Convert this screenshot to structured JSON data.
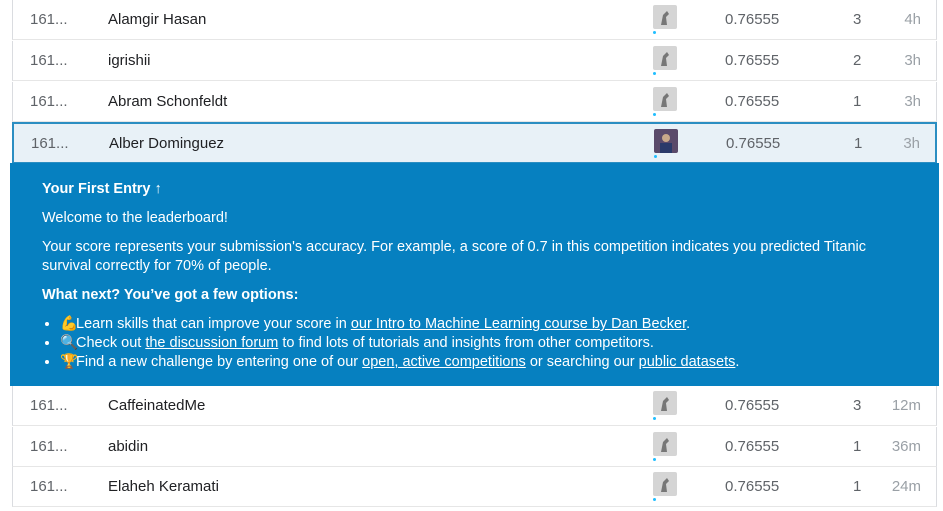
{
  "rows_top": [
    {
      "rank": "161...",
      "name": "Alamgir Hasan",
      "score": "0.76555",
      "entries": "3",
      "last": "4h"
    },
    {
      "rank": "161...",
      "name": "igrishii",
      "score": "0.76555",
      "entries": "2",
      "last": "3h"
    },
    {
      "rank": "161...",
      "name": "Abram Schonfeldt",
      "score": "0.76555",
      "entries": "1",
      "last": "3h"
    },
    {
      "rank": "161...",
      "name": "Alber Dominguez",
      "score": "0.76555",
      "entries": "1",
      "last": "3h"
    }
  ],
  "panel": {
    "title": "Your First Entry",
    "title_icon": "↑",
    "welcome": "Welcome to the leaderboard!",
    "explain": "Your score represents your submission's accuracy. For example, a score of 0.7 in this competition indicates you predicted Titanic survival correctly for 70% of people.",
    "next": "What next? You’ve got a few options:",
    "options": [
      {
        "emoji": "💪",
        "pre": "Learn skills that can improve your score in ",
        "link": "our Intro to Machine Learning course by Dan Becker",
        "post": "."
      },
      {
        "emoji": "🔍",
        "pre": "Check out ",
        "link": "the discussion forum",
        "post": " to find lots of tutorials and insights from other competitors."
      },
      {
        "emoji": "🏆",
        "pre": "Find a new challenge by entering one of our ",
        "link": "open, active competitions",
        "mid": " or searching our ",
        "link2": "public datasets",
        "post": "."
      }
    ]
  },
  "rows_bottom": [
    {
      "rank": "161...",
      "name": "CaffeinatedMe",
      "score": "0.76555",
      "entries": "3",
      "last": "12m"
    },
    {
      "rank": "161...",
      "name": "abidin",
      "score": "0.76555",
      "entries": "1",
      "last": "36m"
    },
    {
      "rank": "161...",
      "name": "Elaheh Keramati",
      "score": "0.76555",
      "entries": "1",
      "last": "24m"
    }
  ],
  "colors": {
    "panel_bg": "#0680c0",
    "highlight_border": "#2b8ec2",
    "highlight_bg": "#e8f1f7"
  }
}
